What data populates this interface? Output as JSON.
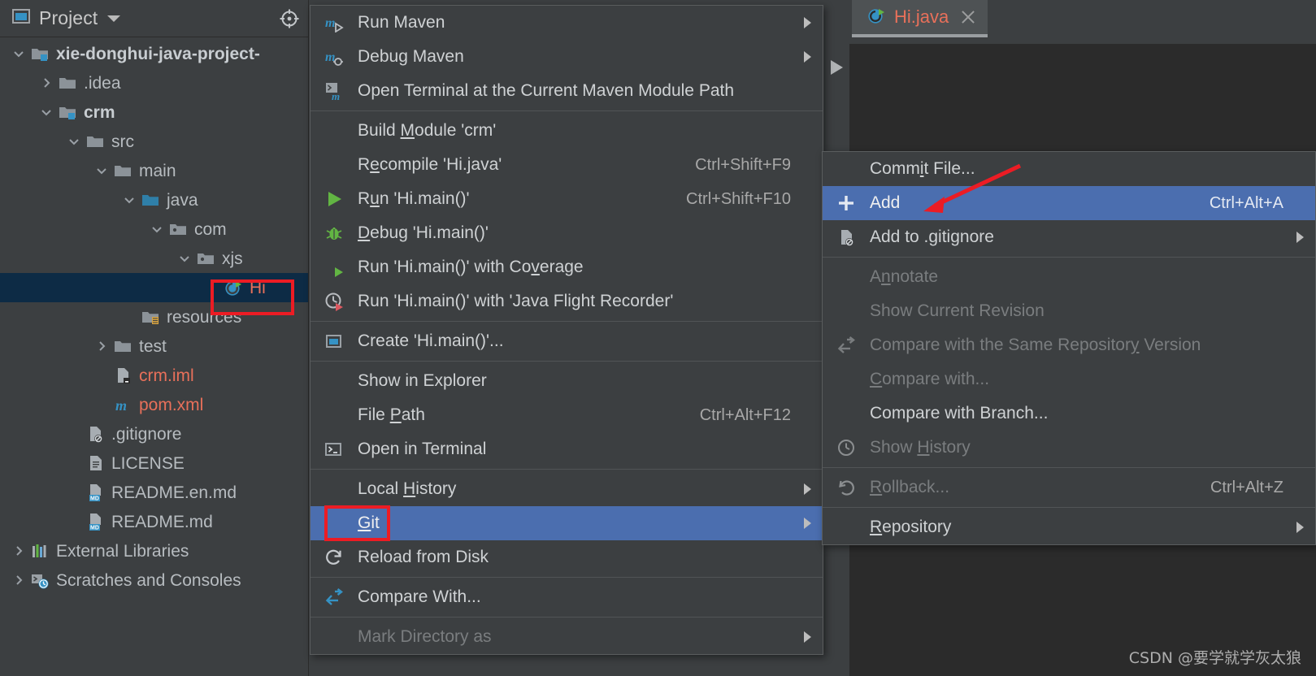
{
  "colors": {
    "panel_bg": "#3c3f41",
    "editor_bg": "#2b2b2b",
    "menu_highlight": "#4b6eaf",
    "tree_selection": "#0d2b45",
    "annotation_red": "#ec1c24",
    "file_red": "#e8705a",
    "accent_blue": "#3592c4"
  },
  "project_panel": {
    "title": "Project",
    "caret_icon": "chevron-down-icon",
    "window_icon": "project-window-icon",
    "locate_icon": "locate-target-icon",
    "tree": [
      {
        "label": "xie-donghui-java-project-",
        "icon": "module-folder-icon",
        "indent": 0,
        "arrow": "expanded",
        "bold": true,
        "color": "default"
      },
      {
        "label": ".idea",
        "icon": "folder-icon",
        "indent": 1,
        "arrow": "collapsed",
        "bold": false,
        "color": "default"
      },
      {
        "label": "crm",
        "icon": "module-folder-icon",
        "indent": 1,
        "arrow": "expanded",
        "bold": true,
        "color": "default"
      },
      {
        "label": "src",
        "icon": "folder-icon",
        "indent": 2,
        "arrow": "expanded",
        "bold": false,
        "color": "default"
      },
      {
        "label": "main",
        "icon": "folder-icon",
        "indent": 3,
        "arrow": "expanded",
        "bold": false,
        "color": "default"
      },
      {
        "label": "java",
        "icon": "source-root-folder-icon",
        "indent": 4,
        "arrow": "expanded",
        "bold": false,
        "color": "default"
      },
      {
        "label": "com",
        "icon": "package-icon",
        "indent": 5,
        "arrow": "expanded",
        "bold": false,
        "color": "default"
      },
      {
        "label": "xjs",
        "icon": "package-icon",
        "indent": 6,
        "arrow": "expanded",
        "bold": false,
        "color": "default"
      },
      {
        "label": "Hi",
        "icon": "java-class-icon",
        "indent": 7,
        "arrow": "none",
        "bold": false,
        "color": "red",
        "selected": true
      },
      {
        "label": "resources",
        "icon": "resources-folder-icon",
        "indent": 4,
        "arrow": "none",
        "bold": false,
        "color": "default"
      },
      {
        "label": "test",
        "icon": "folder-icon",
        "indent": 3,
        "arrow": "collapsed",
        "bold": false,
        "color": "default"
      },
      {
        "label": "crm.iml",
        "icon": "iml-file-icon",
        "indent": 3,
        "arrow": "none",
        "bold": false,
        "color": "red"
      },
      {
        "label": "pom.xml",
        "icon": "maven-pom-icon",
        "indent": 3,
        "arrow": "none",
        "bold": false,
        "color": "red"
      },
      {
        "label": ".gitignore",
        "icon": "gitignore-file-icon",
        "indent": 2,
        "arrow": "none",
        "bold": false,
        "color": "default"
      },
      {
        "label": "LICENSE",
        "icon": "text-file-icon",
        "indent": 2,
        "arrow": "none",
        "bold": false,
        "color": "default"
      },
      {
        "label": "README.en.md",
        "icon": "markdown-file-icon",
        "indent": 2,
        "arrow": "none",
        "bold": false,
        "color": "default"
      },
      {
        "label": "README.md",
        "icon": "markdown-file-icon",
        "indent": 2,
        "arrow": "none",
        "bold": false,
        "color": "default"
      },
      {
        "label": "External Libraries",
        "icon": "libraries-icon",
        "indent": 0,
        "arrow": "collapsed",
        "bold": false,
        "color": "default"
      },
      {
        "label": "Scratches and Consoles",
        "icon": "scratches-icon",
        "indent": 0,
        "arrow": "collapsed",
        "bold": false,
        "color": "default"
      }
    ]
  },
  "context_menu": {
    "items": [
      {
        "type": "item",
        "label": "Run Maven",
        "icon": "maven-run-icon",
        "shortcut": "",
        "submenu": true,
        "disabled": false
      },
      {
        "type": "item",
        "label": "Debug Maven",
        "icon": "maven-debug-icon",
        "shortcut": "",
        "submenu": true,
        "disabled": false
      },
      {
        "type": "item",
        "label": "Open Terminal at the Current Maven Module Path",
        "icon": "maven-terminal-icon",
        "shortcut": "",
        "submenu": false,
        "disabled": false
      },
      {
        "type": "separator"
      },
      {
        "type": "item",
        "label": "Build Module 'crm'",
        "mnemonic": "M",
        "icon": "",
        "shortcut": "",
        "submenu": false,
        "disabled": false
      },
      {
        "type": "item",
        "label": "Recompile 'Hi.java'",
        "mnemonic": "e",
        "icon": "",
        "shortcut": "Ctrl+Shift+F9",
        "submenu": false,
        "disabled": false
      },
      {
        "type": "item",
        "label": "Run 'Hi.main()'",
        "mnemonic": "u",
        "icon": "run-green-arrow-icon",
        "shortcut": "Ctrl+Shift+F10",
        "submenu": false,
        "disabled": false
      },
      {
        "type": "item",
        "label": "Debug 'Hi.main()'",
        "mnemonic": "D",
        "icon": "debug-bug-icon",
        "shortcut": "",
        "submenu": false,
        "disabled": false
      },
      {
        "type": "item",
        "label": "Run 'Hi.main()' with Coverage",
        "mnemonic": "v",
        "icon": "coverage-icon",
        "shortcut": "",
        "submenu": false,
        "disabled": false
      },
      {
        "type": "item",
        "label": "Run 'Hi.main()' with 'Java Flight Recorder'",
        "icon": "flight-recorder-icon",
        "shortcut": "",
        "submenu": false,
        "disabled": false
      },
      {
        "type": "separator"
      },
      {
        "type": "item",
        "label": "Create 'Hi.main()'...",
        "icon": "create-config-icon",
        "shortcut": "",
        "submenu": false,
        "disabled": false
      },
      {
        "type": "separator"
      },
      {
        "type": "item",
        "label": "Show in Explorer",
        "icon": "",
        "shortcut": "",
        "submenu": false,
        "disabled": false
      },
      {
        "type": "item",
        "label": "File Path",
        "mnemonic": "P",
        "icon": "",
        "shortcut": "Ctrl+Alt+F12",
        "submenu": false,
        "disabled": false
      },
      {
        "type": "item",
        "label": "Open in Terminal",
        "icon": "terminal-icon",
        "shortcut": "",
        "submenu": false,
        "disabled": false
      },
      {
        "type": "separator"
      },
      {
        "type": "item",
        "label": "Local History",
        "mnemonic": "H",
        "icon": "",
        "shortcut": "",
        "submenu": true,
        "disabled": false
      },
      {
        "type": "item",
        "label": "Git",
        "mnemonic": "G",
        "icon": "",
        "shortcut": "",
        "submenu": true,
        "disabled": false,
        "highlight": true
      },
      {
        "type": "item",
        "label": "Reload from Disk",
        "icon": "reload-icon",
        "shortcut": "",
        "submenu": false,
        "disabled": false
      },
      {
        "type": "separator"
      },
      {
        "type": "item",
        "label": "Compare With...",
        "icon": "compare-icon",
        "shortcut": "",
        "submenu": false,
        "disabled": false
      },
      {
        "type": "separator"
      },
      {
        "type": "item",
        "label": "Mark Directory as",
        "icon": "",
        "shortcut": "",
        "submenu": true,
        "disabled": true
      }
    ]
  },
  "git_submenu": {
    "items": [
      {
        "type": "item",
        "label": "Commit File...",
        "mnemonic": "i",
        "icon": "",
        "shortcut": "",
        "submenu": false,
        "disabled": false
      },
      {
        "type": "item",
        "label": "Add",
        "icon": "plus-icon",
        "shortcut": "Ctrl+Alt+A",
        "submenu": false,
        "disabled": false,
        "highlight": true
      },
      {
        "type": "item",
        "label": "Add to .gitignore",
        "icon": "gitignore-file-icon",
        "shortcut": "",
        "submenu": true,
        "disabled": false
      },
      {
        "type": "separator"
      },
      {
        "type": "item",
        "label": "Annotate",
        "mnemonic": "n",
        "icon": "",
        "shortcut": "",
        "submenu": false,
        "disabled": true
      },
      {
        "type": "item",
        "label": "Show Current Revision",
        "icon": "",
        "shortcut": "",
        "submenu": false,
        "disabled": true
      },
      {
        "type": "item",
        "label": "Compare with the Same Repository Version",
        "mnemonic": "y",
        "icon": "compare-icon",
        "shortcut": "",
        "submenu": false,
        "disabled": true
      },
      {
        "type": "item",
        "label": "Compare with...",
        "mnemonic": "C",
        "icon": "",
        "shortcut": "",
        "submenu": false,
        "disabled": true
      },
      {
        "type": "item",
        "label": "Compare with Branch...",
        "icon": "",
        "shortcut": "",
        "submenu": false,
        "disabled": false
      },
      {
        "type": "item",
        "label": "Show History",
        "mnemonic": "H",
        "icon": "history-clock-icon",
        "shortcut": "",
        "submenu": false,
        "disabled": true
      },
      {
        "type": "separator"
      },
      {
        "type": "item",
        "label": "Rollback...",
        "mnemonic": "R",
        "icon": "rollback-icon",
        "shortcut": "Ctrl+Alt+Z",
        "submenu": false,
        "disabled": true
      },
      {
        "type": "separator"
      },
      {
        "type": "item",
        "label": "Repository",
        "mnemonic": "R",
        "icon": "",
        "shortcut": "",
        "submenu": true,
        "disabled": false
      }
    ]
  },
  "editor": {
    "tab": {
      "label": "Hi.java",
      "icon": "java-class-icon",
      "close_icon": "close-icon"
    },
    "gutter_run_icon": "run-green-arrow-icon"
  },
  "watermark": "CSDN @要学就学灰太狼"
}
